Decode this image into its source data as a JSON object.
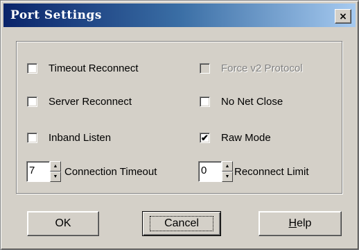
{
  "window": {
    "title": "Port Settings",
    "close_label": "×"
  },
  "options": {
    "timeout_reconnect": {
      "label": "Timeout Reconnect",
      "checked": false
    },
    "force_v2": {
      "label": "Force v2 Protocol",
      "checked": false,
      "disabled": true
    },
    "server_reconnect": {
      "label": "Server Reconnect",
      "checked": false
    },
    "no_net_close": {
      "label": "No Net Close",
      "checked": false
    },
    "inband_listen": {
      "label": "Inband Listen",
      "checked": false
    },
    "raw_mode": {
      "label": "Raw Mode",
      "checked": true,
      "mark": "✔"
    }
  },
  "spinners": {
    "connection_timeout": {
      "value": "7",
      "label": "Connection Timeout"
    },
    "reconnect_limit": {
      "value": "0",
      "label": "Reconnect Limit"
    }
  },
  "buttons": {
    "ok": "OK",
    "cancel": "Cancel",
    "help_mnemonic": "H",
    "help_rest": "elp"
  },
  "glyphs": {
    "up": "▲",
    "down": "▼"
  }
}
